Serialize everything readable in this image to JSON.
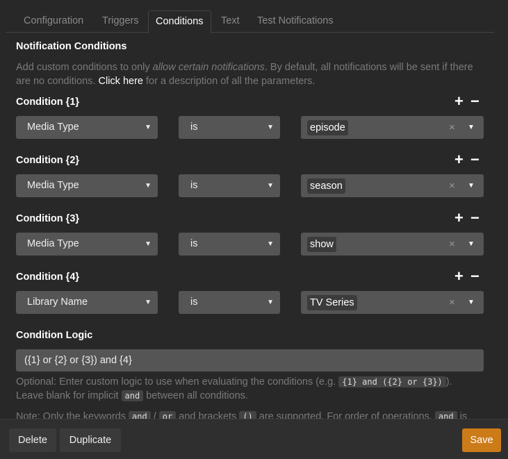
{
  "tabs": [
    {
      "label": "Configuration"
    },
    {
      "label": "Triggers"
    },
    {
      "label": "Conditions"
    },
    {
      "label": "Text"
    },
    {
      "label": "Test Notifications"
    }
  ],
  "section_title": "Notification Conditions",
  "intro": {
    "part1": "Add custom conditions to only ",
    "emph": "allow certain notifications",
    "part2": ". By default, all notifications will be sent if there are no conditions. ",
    "link": "Click here",
    "part3": " for a description of all the parameters."
  },
  "conditions": [
    {
      "title": "Condition {1}",
      "parameter": "Media Type",
      "operator": "is",
      "value": "episode"
    },
    {
      "title": "Condition {2}",
      "parameter": "Media Type",
      "operator": "is",
      "value": "season"
    },
    {
      "title": "Condition {3}",
      "parameter": "Media Type",
      "operator": "is",
      "value": "show"
    },
    {
      "title": "Condition {4}",
      "parameter": "Library Name",
      "operator": "is",
      "value": "TV Series"
    }
  ],
  "icons": {
    "add": "+",
    "remove": "−",
    "clear": "×",
    "chevron": "▼",
    "dropdown": "▼"
  },
  "logic": {
    "title": "Condition Logic",
    "value": "({1} or {2} or {3}) and {4}",
    "help1a": "Optional: Enter custom logic to use when evaluating the conditions (e.g. ",
    "help1_code": "{1} and ({2} or {3})",
    "help1b": ").",
    "help2a": "Leave blank for implicit ",
    "help2_code": "and",
    "help2b": " between all conditions.",
    "note_a": "Note: Only the keywords ",
    "note_code1": "and",
    "note_sep": " / ",
    "note_code2": "or",
    "note_b": " and brackets ",
    "note_code3": "()",
    "note_c": " are supported. For order of operations, ",
    "note_code4": "and",
    "note_d": " is"
  },
  "footer": {
    "delete": "Delete",
    "duplicate": "Duplicate",
    "save": "Save"
  },
  "colors": {
    "background": "#282828",
    "input": "#555555",
    "save": "#cc7b19"
  }
}
